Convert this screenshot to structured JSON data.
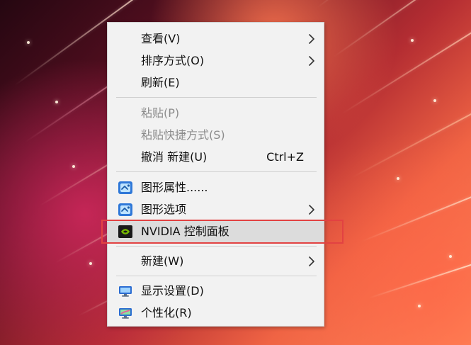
{
  "context_menu": {
    "items": [
      {
        "label": "查看(V)",
        "submenu": true
      },
      {
        "label": "排序方式(O)",
        "submenu": true
      },
      {
        "label": "刷新(E)"
      },
      {
        "label": "粘贴(P)",
        "disabled": true
      },
      {
        "label": "粘贴快捷方式(S)",
        "disabled": true
      },
      {
        "label": "撤消 新建(U)",
        "shortcut": "Ctrl+Z"
      },
      {
        "label": "图形属性......",
        "icon": "intel-graphics-icon"
      },
      {
        "label": "图形选项",
        "icon": "intel-graphics-icon",
        "submenu": true
      },
      {
        "label": "NVIDIA 控制面板",
        "icon": "nvidia-icon",
        "highlighted": true
      },
      {
        "label": "新建(W)",
        "submenu": true
      },
      {
        "label": "显示设置(D)",
        "icon": "display-settings-icon"
      },
      {
        "label": "个性化(R)",
        "icon": "personalize-icon"
      }
    ]
  },
  "colors": {
    "menu_background": "#f2f2f2",
    "highlight_background": "#dcdcdc",
    "annotation_box": "#e24242",
    "disabled_text": "#8c8c8c"
  }
}
